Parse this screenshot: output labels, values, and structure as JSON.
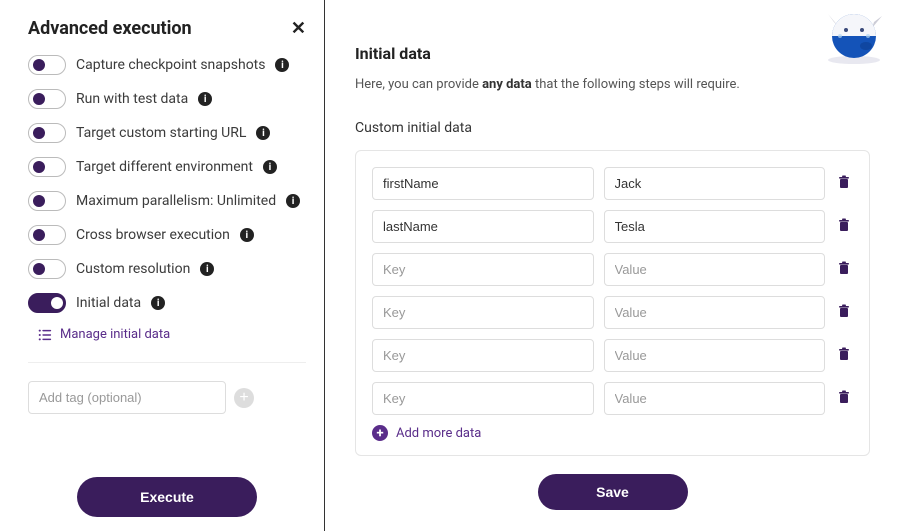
{
  "left": {
    "title": "Advanced execution",
    "options": [
      {
        "label": "Capture checkpoint snapshots",
        "on": false,
        "info": true
      },
      {
        "label": "Run with test data",
        "on": false,
        "info": true
      },
      {
        "label": "Target custom starting URL",
        "on": false,
        "info": true
      },
      {
        "label": "Target different environment",
        "on": false,
        "info": true
      },
      {
        "label": "Maximum parallelism: Unlimited",
        "on": false,
        "info": true
      },
      {
        "label": "Cross browser execution",
        "on": false,
        "info": true
      },
      {
        "label": "Custom resolution",
        "on": false,
        "info": true
      },
      {
        "label": "Initial data",
        "on": true,
        "info": true
      }
    ],
    "manage_link": "Manage initial data",
    "tag_placeholder": "Add tag (optional)",
    "execute_label": "Execute"
  },
  "right": {
    "title": "Initial data",
    "desc_pre": "Here, you can provide ",
    "desc_bold": "any data",
    "desc_post": " that the following steps will require.",
    "section_label": "Custom initial data",
    "key_placeholder": "Key",
    "value_placeholder": "Value",
    "rows": [
      {
        "key": "firstName",
        "value": "Jack"
      },
      {
        "key": "lastName",
        "value": "Tesla"
      },
      {
        "key": "",
        "value": ""
      },
      {
        "key": "",
        "value": ""
      },
      {
        "key": "",
        "value": ""
      },
      {
        "key": "",
        "value": ""
      }
    ],
    "add_more_label": "Add more data",
    "save_label": "Save"
  }
}
